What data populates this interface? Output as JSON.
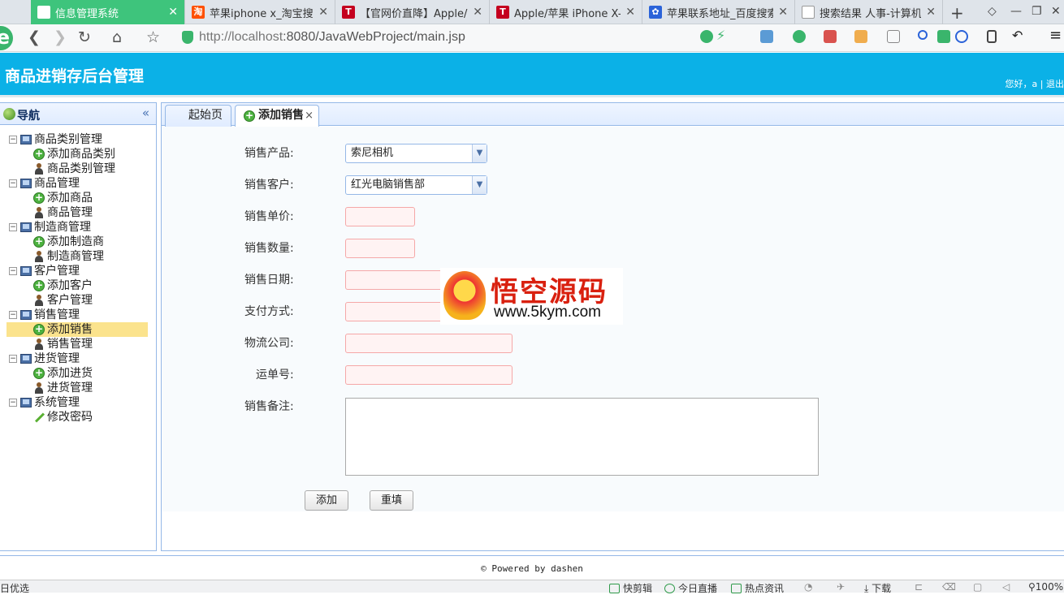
{
  "browser": {
    "tabs": [
      {
        "title": "信息管理系统",
        "active": true
      },
      {
        "title": "苹果iphone x_淘宝搜索"
      },
      {
        "title": "【官网价直降】Apple/苹"
      },
      {
        "title": "Apple/苹果 iPhone X-t"
      },
      {
        "title": "苹果联系地址_百度搜索"
      },
      {
        "title": "搜索结果 人事-计算机毕"
      }
    ],
    "new_tab": "+",
    "url_host": "http://localhost",
    "url_path": ":8080/JavaWebProject/main.jsp"
  },
  "app": {
    "title": "商品进销存后台管理",
    "welcome": "您好，a  |  退出"
  },
  "nav": {
    "title": "导航",
    "collapse": "«",
    "groups": [
      {
        "label": "商品类别管理",
        "items": [
          "添加商品类别",
          "商品类别管理"
        ]
      },
      {
        "label": "商品管理",
        "items": [
          "添加商品",
          "商品管理"
        ]
      },
      {
        "label": "制造商管理",
        "items": [
          "添加制造商",
          "制造商管理"
        ]
      },
      {
        "label": "客户管理",
        "items": [
          "添加客户",
          "客户管理"
        ]
      },
      {
        "label": "销售管理",
        "items": [
          "添加销售",
          "销售管理"
        ]
      },
      {
        "label": "进货管理",
        "items": [
          "添加进货",
          "进货管理"
        ]
      },
      {
        "label": "系统管理",
        "items": [
          "修改密码"
        ]
      }
    ]
  },
  "content_tabs": {
    "home": "起始页",
    "active": "添加销售",
    "close": "×"
  },
  "form": {
    "product_label": "销售产品:",
    "product_value": "索尼相机",
    "customer_label": "销售客户:",
    "customer_value": "红光电脑销售部",
    "price_label": "销售单价:",
    "quantity_label": "销售数量:",
    "date_label": "销售日期:",
    "payment_label": "支付方式:",
    "logistics_label": "物流公司:",
    "tracking_label": "运单号:",
    "remark_label": "销售备注:",
    "add_button": "添加",
    "reset_button": "重填"
  },
  "watermark": {
    "text": "悟空源码",
    "url": "www.5kym.com"
  },
  "footer": "© Powered by dashen",
  "statusbar": {
    "left": "日优选",
    "items": [
      "快剪辑",
      "今日直播",
      "热点资讯",
      "下载",
      "100%"
    ]
  },
  "colors": {
    "header": "#0bb1e7",
    "active_browser_tab": "#3ec47c",
    "selected_nav": "#fbe38d"
  }
}
